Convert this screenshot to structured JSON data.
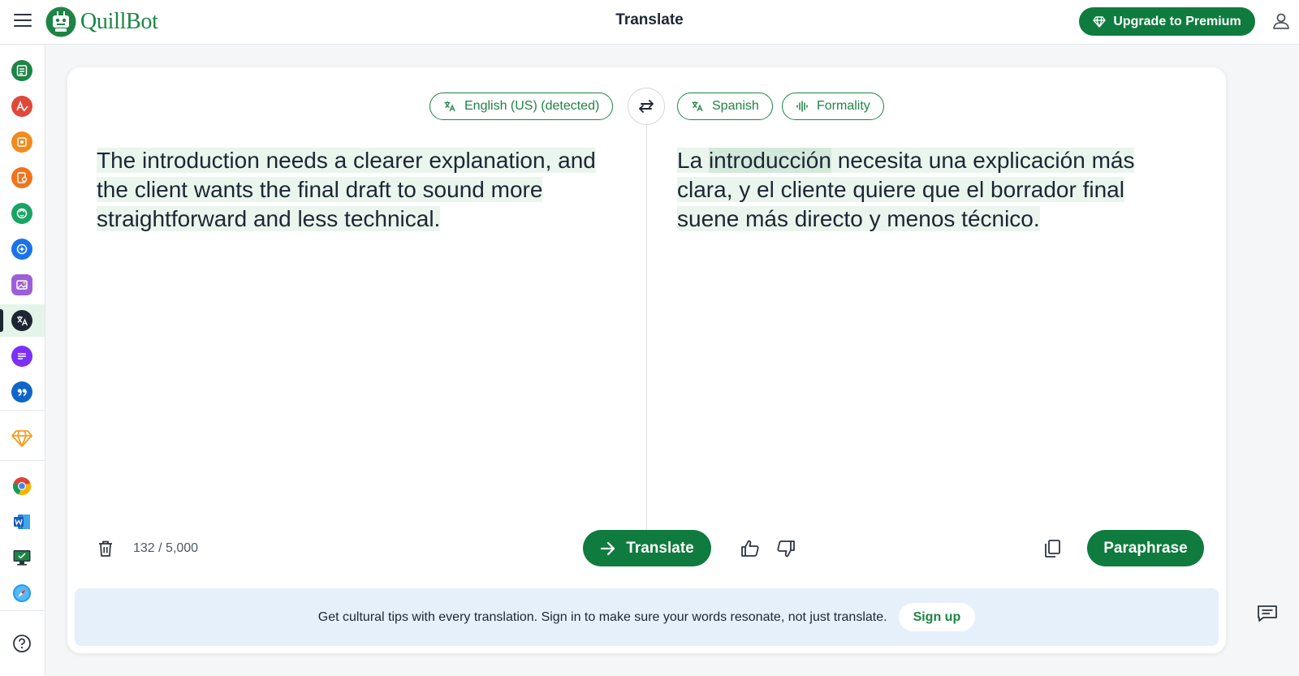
{
  "header": {
    "logo_text": "QuillBot",
    "page_title": "Translate",
    "premium_label": "Upgrade to Premium"
  },
  "sidebar": {
    "items": [
      {
        "name": "paraphraser",
        "color": "#1e8446"
      },
      {
        "name": "grammar-checker",
        "color": "#e2483a"
      },
      {
        "name": "ai-detector",
        "color": "#f28b1d"
      },
      {
        "name": "plagiarism-checker",
        "color": "#f0741d"
      },
      {
        "name": "ai-humanizer",
        "color": "#19a463"
      },
      {
        "name": "ai-chat",
        "color": "#1c73e8"
      },
      {
        "name": "ai-image-generator",
        "color": "#9c5fd8"
      },
      {
        "name": "translate",
        "color": "#1d2733"
      },
      {
        "name": "summarizer",
        "color": "#7b2ff7"
      },
      {
        "name": "citation-generator",
        "color": "#1066c8"
      }
    ],
    "premium_color": "#f0a020"
  },
  "source": {
    "language": "English (US) (detected)",
    "text": [
      "The introduction needs a clearer explanation, and",
      "the client wants the final draft to sound more",
      "straightforward and less technical."
    ],
    "counter": "132 / 5,000"
  },
  "target": {
    "language": "Spanish",
    "formality_label": "Formality",
    "line1_prefix": "La ",
    "line1_highlight": "introducción",
    "line1_suffix": " necesita una explicación más",
    "line2": "clara, y el cliente quiere que el borrador final",
    "line3": "suene más directo y menos técnico."
  },
  "actions": {
    "translate_label": "Translate",
    "paraphrase_label": "Paraphrase"
  },
  "banner": {
    "text": "Get cultural tips with every translation. Sign in to make sure your words resonate, not just translate.",
    "signup_label": "Sign up"
  },
  "colors": {
    "brand_green": "#0f7b3e",
    "highlight": "#eaf5ee",
    "banner_bg": "#e6f0fa"
  }
}
